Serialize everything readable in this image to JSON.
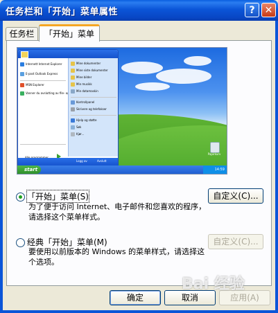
{
  "window": {
    "title": "任务栏和「开始」菜单属性",
    "help_button": "?",
    "close_button": "✕"
  },
  "tabs": [
    {
      "label": "任务栏",
      "active": false
    },
    {
      "label": "「开始」菜单",
      "active": true
    }
  ],
  "preview": {
    "start_menu": {
      "left_items": [
        "Internett\nInternet Explorer",
        "E-post\nOutlook Express",
        "MSN Explorer",
        "Vanner du avslutting av\nfile- og innstillinger"
      ],
      "right_items": [
        "Mine dokumenter",
        "Mine siste dokumenter",
        "Mine bilder",
        "Min musikk",
        "Min datamaskin",
        "Kontrollpanel",
        "Skrivere og telefakser",
        "Hjelp og støtte",
        "Søk",
        "Kjør..."
      ],
      "all_programs": "Alle programmer",
      "log_off": "Logg av",
      "shut_down": "Avslutt"
    },
    "taskbar": {
      "start_label": "start",
      "tray_time": "14:59"
    },
    "desktop_icon_label": "Papirkurv"
  },
  "options": [
    {
      "label": "「开始」菜单(S)",
      "description": "为了便于访问 Internet、电子邮件和您喜欢的程序，请选择这个菜单样式。",
      "checked": true,
      "button": "自定义(C)...",
      "button_enabled": true
    },
    {
      "label": "经典「开始」菜单(M)",
      "description": "要使用以前版本的 Windows 的菜单样式，请选择这个选项。",
      "checked": false,
      "button": "自定义(C)...",
      "button_enabled": false
    }
  ],
  "footer": {
    "ok": "确定",
    "cancel": "取消",
    "apply": "应用(A)"
  },
  "watermark": "Bai 经验"
}
